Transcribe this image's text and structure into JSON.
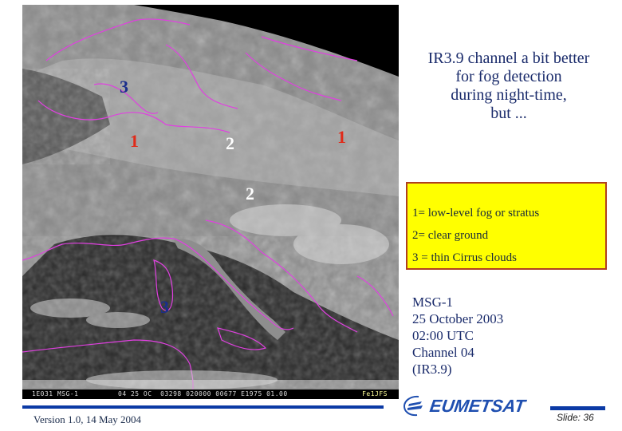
{
  "slide": {
    "heading_lines": [
      "IR3.9 channel a bit better",
      "for fog detection",
      "during night-time,",
      "but ..."
    ],
    "legend": {
      "items": [
        "1= low-level fog or stratus",
        "2= clear ground",
        "3 = thin Cirrus clouds"
      ],
      "background": "#ffff00",
      "border": "#b0401f"
    },
    "image_info": [
      "MSG-1",
      "25 October 2003",
      "02:00 UTC",
      "Channel 04",
      "(IR3.9)"
    ],
    "footer": {
      "version": "Version 1.0, 14 May 2004",
      "logo_text": "EUMETSAT",
      "slide_number": "Slide: 36"
    }
  },
  "satellite_image": {
    "description": "MSG-1 IR3.9 night-time image over Europe with magenta coastlines",
    "coastline_color": "#e040e0",
    "markers": [
      {
        "label": "3",
        "meaning": "thin Cirrus clouds",
        "color": "#1a2e8c"
      },
      {
        "label": "1",
        "meaning": "low-level fog or stratus",
        "color": "#e02b1a"
      },
      {
        "label": "2",
        "meaning": "clear ground",
        "color": "#ffffff"
      },
      {
        "label": "1",
        "meaning": "low-level fog or stratus",
        "color": "#e02b1a"
      },
      {
        "label": "2",
        "meaning": "clear ground",
        "color": "#ffffff"
      },
      {
        "label": "3",
        "meaning": "thin Cirrus clouds",
        "color": "#1a2e8c"
      }
    ],
    "status_bar": {
      "left": "1E031 MSG-1",
      "middle": "04 25 OC  03298 020000 00677 E1975 01.00",
      "right": "Fe1JFS"
    }
  }
}
